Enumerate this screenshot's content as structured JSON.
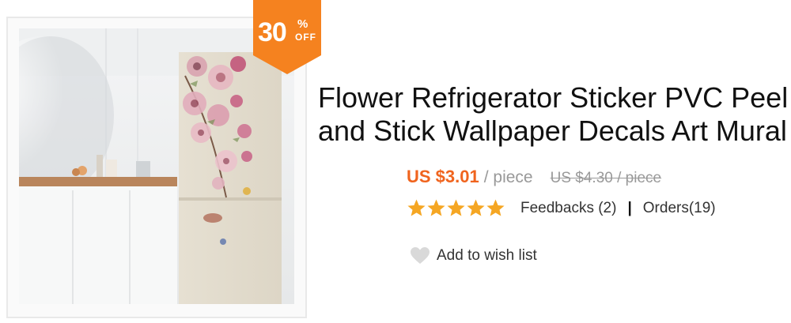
{
  "product": {
    "title_line1": "Flower Refrigerator Sticker PVC Peel",
    "title_line2": "and Stick Wallpaper Decals Art Mural",
    "image_alt": "Refrigerator with pink flower wallpaper decal in a kitchen"
  },
  "badge": {
    "number": "30",
    "percent": "%",
    "off": "OFF",
    "color": "#f5821f"
  },
  "price": {
    "current": "US $3.01",
    "unit": "/ piece",
    "original": "US $4.30 / piece",
    "accent_color": "#f0641e"
  },
  "rating": {
    "stars": 5,
    "star_color": "#f5a623",
    "feedbacks": "Feedbacks (2)",
    "separator": "|",
    "orders": "Orders(19)"
  },
  "wishlist": {
    "label": "Add to wish list",
    "icon": "heart-icon"
  }
}
